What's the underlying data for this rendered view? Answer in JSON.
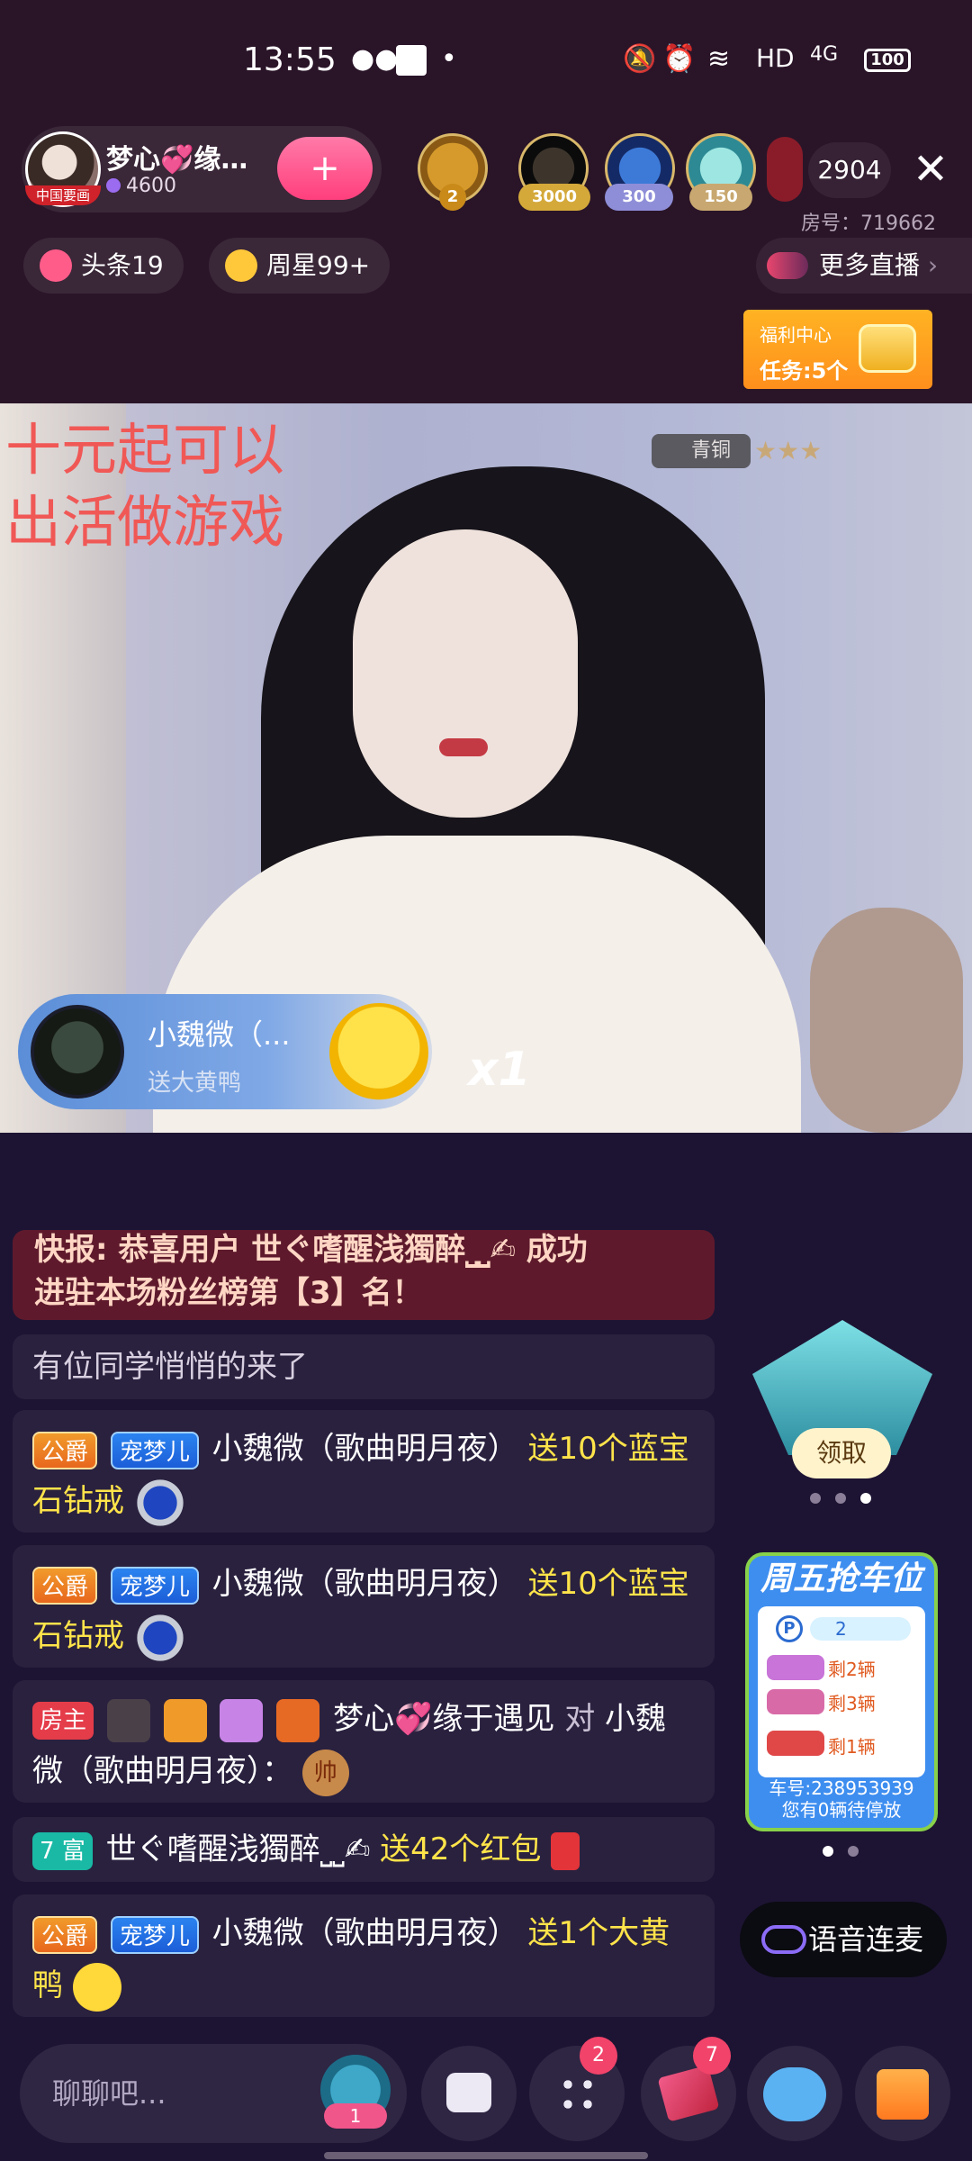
{
  "status_bar": {
    "time": "13:55",
    "network": "HD",
    "signal": "4G",
    "battery": "100"
  },
  "header": {
    "host_name": "梦心💞缘…",
    "host_tag": "中国要画",
    "host_score": "4600",
    "viewer_badges": [
      "2",
      "3000",
      "300",
      "150"
    ],
    "online_count": "2904",
    "room_id": "房号：719662",
    "chips": [
      {
        "label": "头条19",
        "color": "#ff5c8a"
      },
      {
        "label": "周星99+",
        "color": "#ffc83a"
      }
    ],
    "more_live": "更多直播",
    "welfare_title": "福利中心",
    "welfare_task": "任务:5个"
  },
  "video": {
    "overlay_text_line1": "十元起可以",
    "overlay_text_line2": "出活做游戏",
    "rank_badge": "青铜",
    "stars": "★★★",
    "gift": {
      "user": "小魏微（...",
      "item": "送大黄鸭",
      "multiplier": "x1"
    }
  },
  "chat": {
    "notice_line1": "快报: 恭喜用户 世ぐ嗜醒浅獨醉⎵⎵✍ 成功",
    "notice_line2": "进驻本场粉丝榜第【3】名！",
    "enter_msg": "有位同学悄悄的来了",
    "tags": {
      "duke": "公爵",
      "pet": "宠梦儿",
      "owner": "房主",
      "rich": "7 富"
    },
    "messages": [
      {
        "name": "小魏微（歌曲明月夜）",
        "gift": "送10个蓝宝石钻戒"
      },
      {
        "name": "小魏微（歌曲明月夜）",
        "gift": "送10个蓝宝石钻戒"
      },
      {
        "name": "梦心💞缘于遇见",
        "to": "对",
        "target": "小魏微（歌曲明月夜）：",
        "emoji": "帅"
      },
      {
        "name": "世ぐ嗜醒浅獨醉⎵⎵✍",
        "gift": "送42个红包"
      },
      {
        "name": "小魏微（歌曲明月夜）",
        "gift": "送1个大黄鸭"
      }
    ]
  },
  "side_panel": {
    "claim_label": "领取",
    "friday_title": "周五抢车位",
    "parking_value": "2",
    "cars_left": [
      "剩2辆",
      "剩3辆",
      "剩1辆"
    ],
    "car_number": "车号:238953939",
    "waiting": "您有0辆待停放",
    "voice_label": "语音连麦"
  },
  "bottom_bar": {
    "chat_placeholder": "聊聊吧...",
    "fan_badge": "1",
    "apps_badge": "2",
    "gift_box_badge": "7"
  }
}
